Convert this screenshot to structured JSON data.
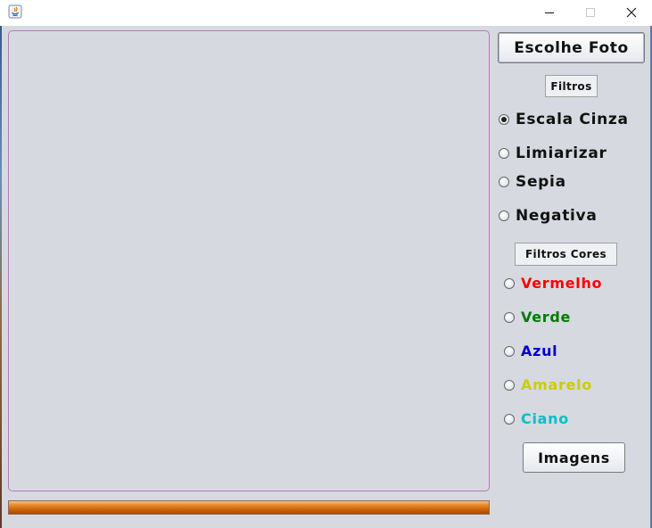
{
  "window": {
    "app_icon": "java-icon",
    "controls": {
      "minimize": "minimize-icon",
      "maximize": "maximize-icon",
      "close": "close-icon"
    }
  },
  "choose_photo_label": "Escolhe Foto",
  "filters": {
    "label": "Filtros",
    "options": [
      {
        "label": "Escala Cinza",
        "selected": true
      },
      {
        "label": "Limiarizar",
        "selected": false
      },
      {
        "label": "Sepia",
        "selected": false
      },
      {
        "label": "Negativa",
        "selected": false
      }
    ]
  },
  "color_filters": {
    "label": "Filtros Cores",
    "options": [
      {
        "label": "Vermelho",
        "color": "#ff0000",
        "selected": false
      },
      {
        "label": "Verde",
        "color": "#007a00",
        "selected": false
      },
      {
        "label": "Azul",
        "color": "#0000cc",
        "selected": false
      },
      {
        "label": "Amarelo",
        "color": "#cccc00",
        "selected": false
      },
      {
        "label": "Ciano",
        "color": "#00c0c8",
        "selected": false
      }
    ]
  },
  "images_button_label": "Imagens",
  "progress": {
    "value_fraction": 1.0,
    "color": "#e07a1a"
  }
}
